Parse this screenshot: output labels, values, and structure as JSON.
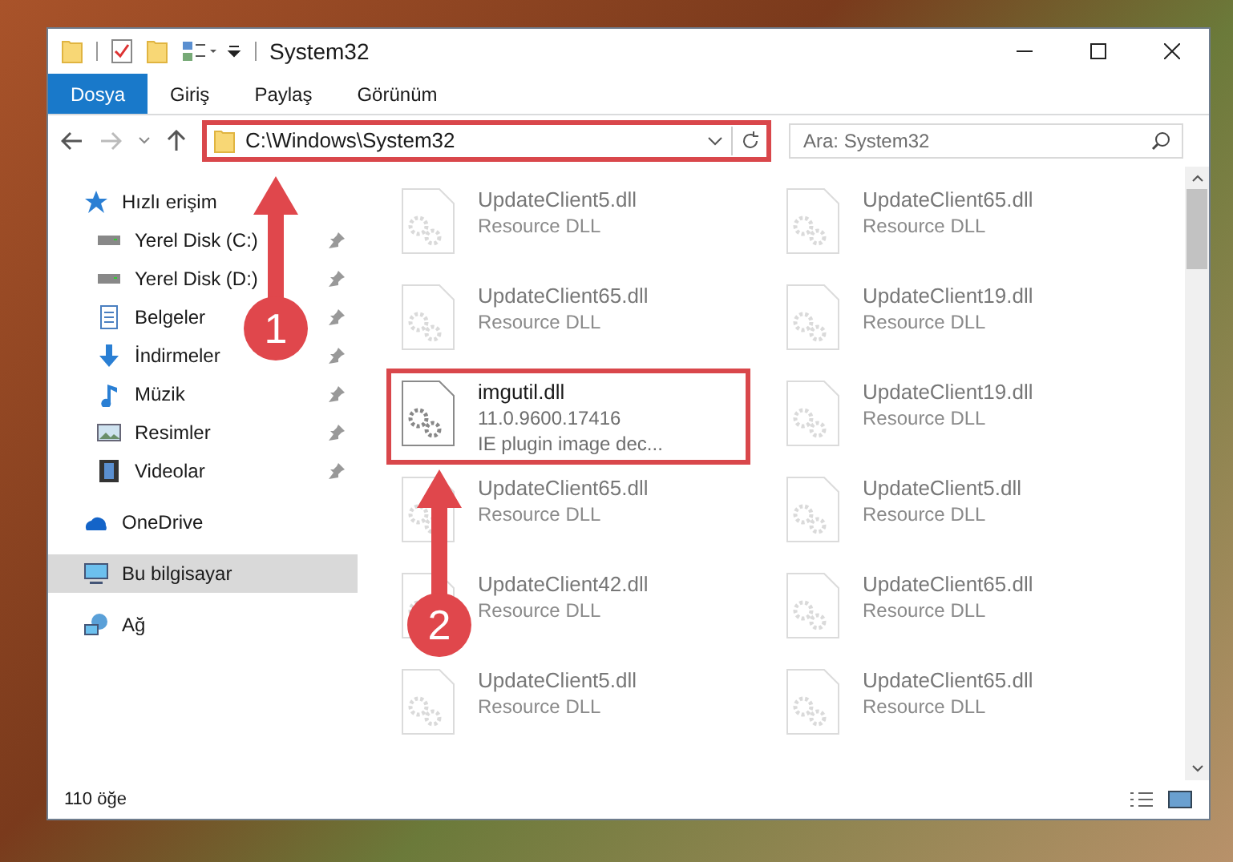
{
  "window": {
    "title": "System32"
  },
  "ribbon_tabs": [
    {
      "label": "Dosya",
      "selected": true
    },
    {
      "label": "Giriş",
      "selected": false
    },
    {
      "label": "Paylaş",
      "selected": false
    },
    {
      "label": "Görünüm",
      "selected": false
    }
  ],
  "address_bar": {
    "path": "C:\\Windows\\System32",
    "highlighted": true
  },
  "search": {
    "placeholder": "Ara: System32"
  },
  "sidebar": [
    {
      "label": "Hızlı erişim",
      "kind": "star",
      "selected": false,
      "children": [
        {
          "label": "Yerel Disk (C:)",
          "kind": "drive",
          "pinned": true
        },
        {
          "label": "Yerel Disk (D:)",
          "kind": "drive",
          "pinned": true
        },
        {
          "label": "Belgeler",
          "kind": "document",
          "pinned": true
        },
        {
          "label": "İndirmeler",
          "kind": "download",
          "pinned": true
        },
        {
          "label": "Müzik",
          "kind": "music",
          "pinned": true
        },
        {
          "label": "Resimler",
          "kind": "picture",
          "pinned": true
        },
        {
          "label": "Videolar",
          "kind": "video",
          "pinned": true
        }
      ]
    },
    {
      "label": "OneDrive",
      "kind": "cloud",
      "selected": false
    },
    {
      "label": "Bu bilgisayar",
      "kind": "computer",
      "selected": true
    },
    {
      "label": "Ağ",
      "kind": "network",
      "selected": false
    }
  ],
  "files": [
    {
      "name": "UpdateClient5.dll",
      "details": [
        "Resource DLL"
      ],
      "blurred": true,
      "highlighted": false
    },
    {
      "name": "UpdateClient65.dll",
      "details": [
        "Resource DLL"
      ],
      "blurred": true,
      "highlighted": false
    },
    {
      "name": "UpdateClient65.dll",
      "details": [
        "Resource DLL"
      ],
      "blurred": true,
      "highlighted": false
    },
    {
      "name": "UpdateClient19.dll",
      "details": [
        "Resource DLL"
      ],
      "blurred": true,
      "highlighted": false
    },
    {
      "name": "imgutil.dll",
      "details": [
        "11.0.9600.17416",
        "IE plugin image dec..."
      ],
      "blurred": false,
      "highlighted": true
    },
    {
      "name": "UpdateClient19.dll",
      "details": [
        "Resource DLL"
      ],
      "blurred": true,
      "highlighted": false
    },
    {
      "name": "UpdateClient65.dll",
      "details": [
        "Resource DLL"
      ],
      "blurred": true,
      "highlighted": false
    },
    {
      "name": "UpdateClient5.dll",
      "details": [
        "Resource DLL"
      ],
      "blurred": true,
      "highlighted": false
    },
    {
      "name": "UpdateClient42.dll",
      "details": [
        "Resource DLL"
      ],
      "blurred": true,
      "highlighted": false
    },
    {
      "name": "UpdateClient65.dll",
      "details": [
        "Resource DLL"
      ],
      "blurred": true,
      "highlighted": false
    },
    {
      "name": "UpdateClient5.dll",
      "details": [
        "Resource DLL"
      ],
      "blurred": true,
      "highlighted": false
    },
    {
      "name": "UpdateClient65.dll",
      "details": [
        "Resource DLL"
      ],
      "blurred": true,
      "highlighted": false
    }
  ],
  "status_bar": {
    "item_count": "110 öğe"
  },
  "annotations": [
    {
      "number": "1"
    },
    {
      "number": "2"
    }
  ]
}
